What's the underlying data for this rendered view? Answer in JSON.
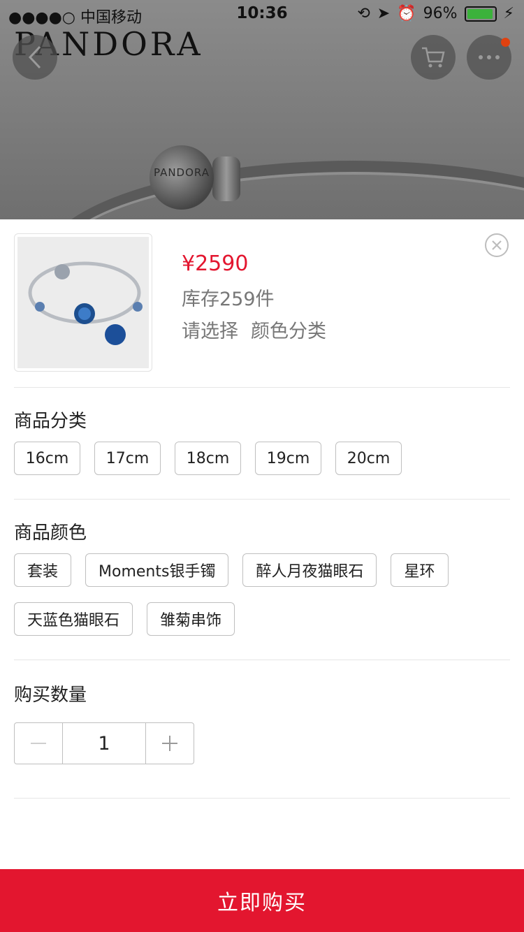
{
  "status_bar": {
    "carrier": "●●●●○ 中国移动",
    "time": "10:36",
    "battery": "96%",
    "battery_level": 0.96,
    "battery_color": "#3bb23b"
  },
  "background": {
    "brand": "PANDORA",
    "bead_text": "PANDORA"
  },
  "nav": {
    "back_icon": "chevron-left-icon",
    "cart_icon": "cart-icon",
    "more_icon": "more-dots-icon",
    "badge_color": "#e0410f"
  },
  "product": {
    "price": "¥2590",
    "stock": "库存259件",
    "choose_prefix": "请选择",
    "choose_value": "颜色分类"
  },
  "sections": {
    "size": {
      "title": "商品分类",
      "options": [
        "16cm",
        "17cm",
        "18cm",
        "19cm",
        "20cm"
      ]
    },
    "color": {
      "title": "商品颜色",
      "options": [
        "套装",
        "Moments银手镯",
        "醉人月夜猫眼石",
        "星环",
        "天蓝色猫眼石",
        "雏菊串饰"
      ]
    },
    "quantity": {
      "title": "购买数量",
      "value": "1"
    }
  },
  "buy_button": "立即购买",
  "colors": {
    "accent": "#e3162f"
  }
}
